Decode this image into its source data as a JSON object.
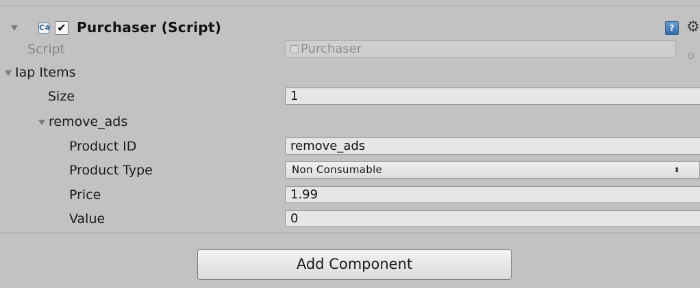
{
  "component": {
    "title": "Purchaser (Script)",
    "enabled": true,
    "checkbox_glyph": "✔",
    "script_icon_glyph": "C#",
    "help_icon_glyph": "?",
    "gear_glyph": "⚙"
  },
  "script_field": {
    "label": "Script",
    "value": "Purchaser",
    "picker_glyph": "⊙"
  },
  "iap_items": {
    "label": "Iap Items",
    "size_label": "Size",
    "size_value": "1",
    "element": {
      "name": "remove_ads",
      "product_id_label": "Product ID",
      "product_id_value": "remove_ads",
      "product_type_label": "Product Type",
      "product_type_value": "Non Consumable",
      "price_label": "Price",
      "price_value": "1.99",
      "value_label": "Value",
      "value_value": "0"
    }
  },
  "add_component": {
    "label": "Add Component"
  },
  "colors": {
    "panel_bg": "#c2c2c2",
    "field_bg": "#e6e6e6",
    "help_blue": "#2f6aad"
  }
}
